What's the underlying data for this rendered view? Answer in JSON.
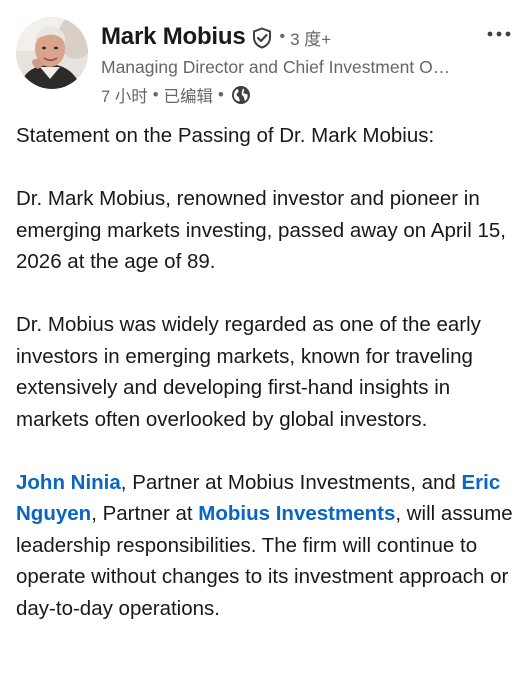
{
  "post": {
    "author": {
      "name": "Mark Mobius",
      "connection_degree": "3 度+",
      "headline": "Managing Director and Chief Investment Officer",
      "time": "7 小时",
      "edited": "已编辑",
      "verified_icon": "verified-shield-icon",
      "visibility_icon": "globe-icon"
    },
    "menu_icon": "more-options-icon",
    "body": {
      "title": "Statement on the Passing of Dr. Mark Mobius:",
      "paragraph1": "Dr. Mark Mobius, renowned investor and pioneer in emerging markets investing, passed away on April 15, 2026 at the age of 89.",
      "paragraph2": "Dr. Mobius was widely regarded as one of the early investors in emerging markets, known for traveling extensively and developing first-hand insights in markets often overlooked by global investors.",
      "paragraph3": {
        "mention1": "John Ninia",
        "text1": ", Partner at Mobius Investments, and ",
        "mention2": "Eric Nguyen",
        "text2": ", Partner at ",
        "mention3": "Mobius Investments",
        "text3": ", will assume leadership responsibilities. The firm will continue to operate without changes to its investment approach or day-to-day operations."
      }
    },
    "colors": {
      "link": "#0a66c2",
      "text": "#191919",
      "muted": "#666666"
    }
  }
}
